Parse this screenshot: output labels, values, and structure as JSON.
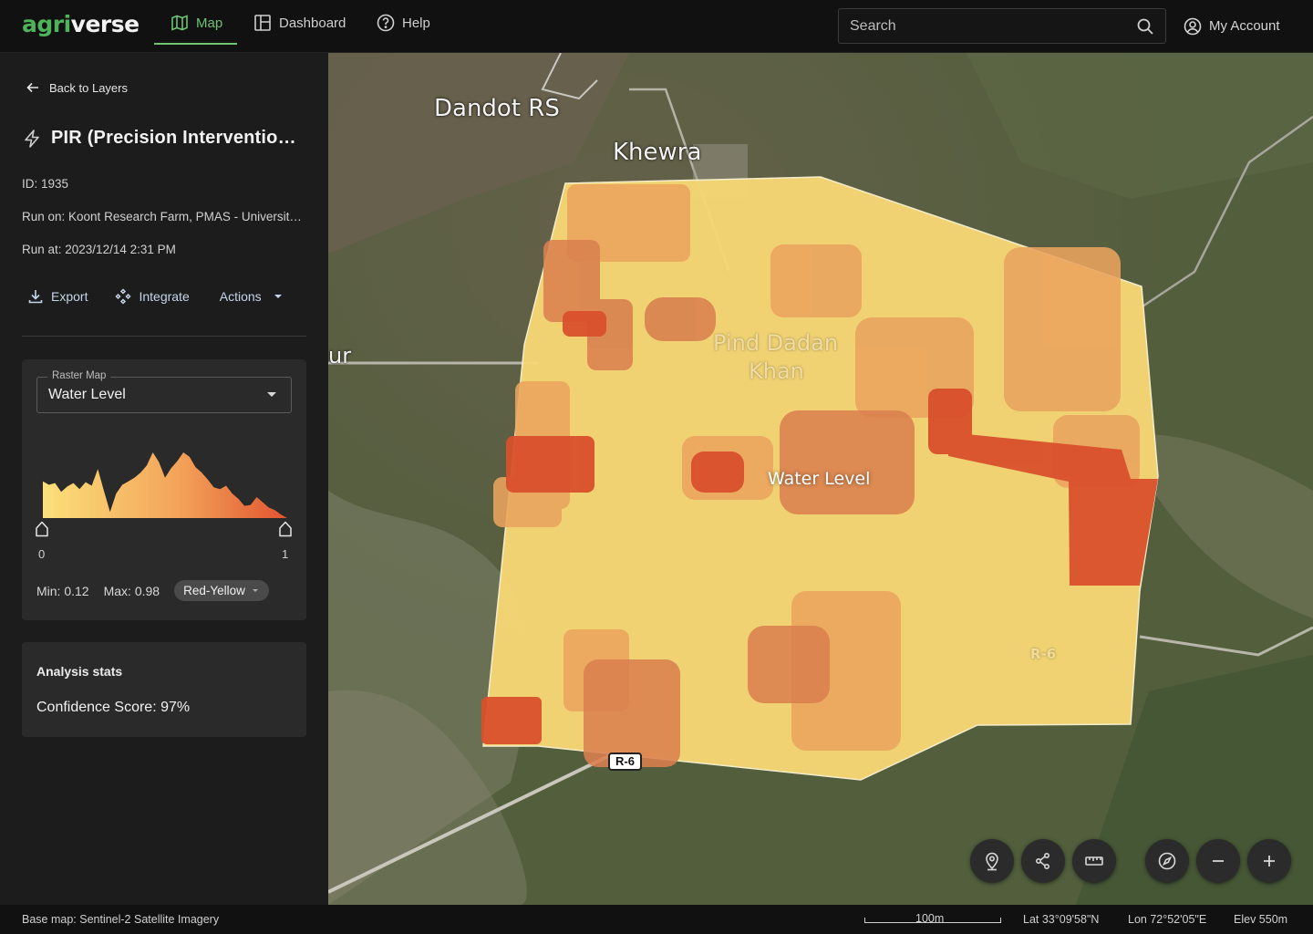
{
  "app": {
    "logo_prefix": "agri",
    "logo_suffix": "verse"
  },
  "nav": {
    "items": [
      {
        "label": "Map",
        "icon": "map-icon",
        "active": true
      },
      {
        "label": "Dashboard",
        "icon": "dashboard-icon",
        "active": false
      },
      {
        "label": "Help",
        "icon": "help-icon",
        "active": false
      }
    ],
    "search_placeholder": "Search",
    "account_label": "My Account"
  },
  "sidebar": {
    "back_label": "Back to Layers",
    "title": "PIR (Precision Intervention Report)",
    "id_text": "ID: 1935",
    "run_on_text": "Run on: Koont Research Farm, PMAS - University Research Farm",
    "run_at_text": "Run at: 2023/12/14 2:31 PM",
    "actions": {
      "export_label": "Export",
      "integrate_label": "Integrate",
      "actions_label": "Actions"
    },
    "raster": {
      "select_label": "Raster Map",
      "selected_value": "Water Level",
      "range_min_tick": "0",
      "range_max_tick": "1",
      "min_text": "Min: 0.12",
      "max_text": "Max: 0.98",
      "palette_label": "Red-Yellow",
      "histogram": {
        "type": "area",
        "values": [
          0.42,
          0.38,
          0.4,
          0.3,
          0.36,
          0.4,
          0.33,
          0.41,
          0.37,
          0.56,
          0.31,
          0.07,
          0.28,
          0.38,
          0.42,
          0.46,
          0.52,
          0.6,
          0.75,
          0.64,
          0.46,
          0.57,
          0.65,
          0.75,
          0.7,
          0.58,
          0.52,
          0.44,
          0.35,
          0.33,
          0.37,
          0.28,
          0.22,
          0.14,
          0.15,
          0.24,
          0.18,
          0.12,
          0.09,
          0.04,
          0.0
        ],
        "gradient": [
          "#fbe07a",
          "#f3a45a",
          "#e2542f"
        ]
      }
    },
    "analysis": {
      "title": "Analysis stats",
      "confidence_text": "Confidence Score: 97%"
    }
  },
  "map": {
    "labels": {
      "dandot": "Dandot RS",
      "khewra": "Khewra",
      "pind_dadan_1": "Pind Dadan",
      "pind_dadan_2": "Khan",
      "ur": "ur",
      "road_r6": "R-6",
      "road_r6_faded": "R-6"
    },
    "overlay_label": "Water Level",
    "controls": [
      "pin-icon",
      "share-nodes-icon",
      "ruler-icon",
      "compass-icon",
      "zoom-out-icon",
      "zoom-in-icon"
    ],
    "colors": {
      "low": "#f7d775",
      "mid": "#eaa45e",
      "high": "#d97a4c",
      "critical": "#d9502c"
    }
  },
  "footer": {
    "base_map_text": "Base map: Sentinel-2 Satellite Imagery",
    "scale_text": "100m",
    "lat_text": "Lat 33°09'58\"N",
    "lon_text": "Lon 72°52'05\"E",
    "elev_text": "Elev 550m"
  }
}
